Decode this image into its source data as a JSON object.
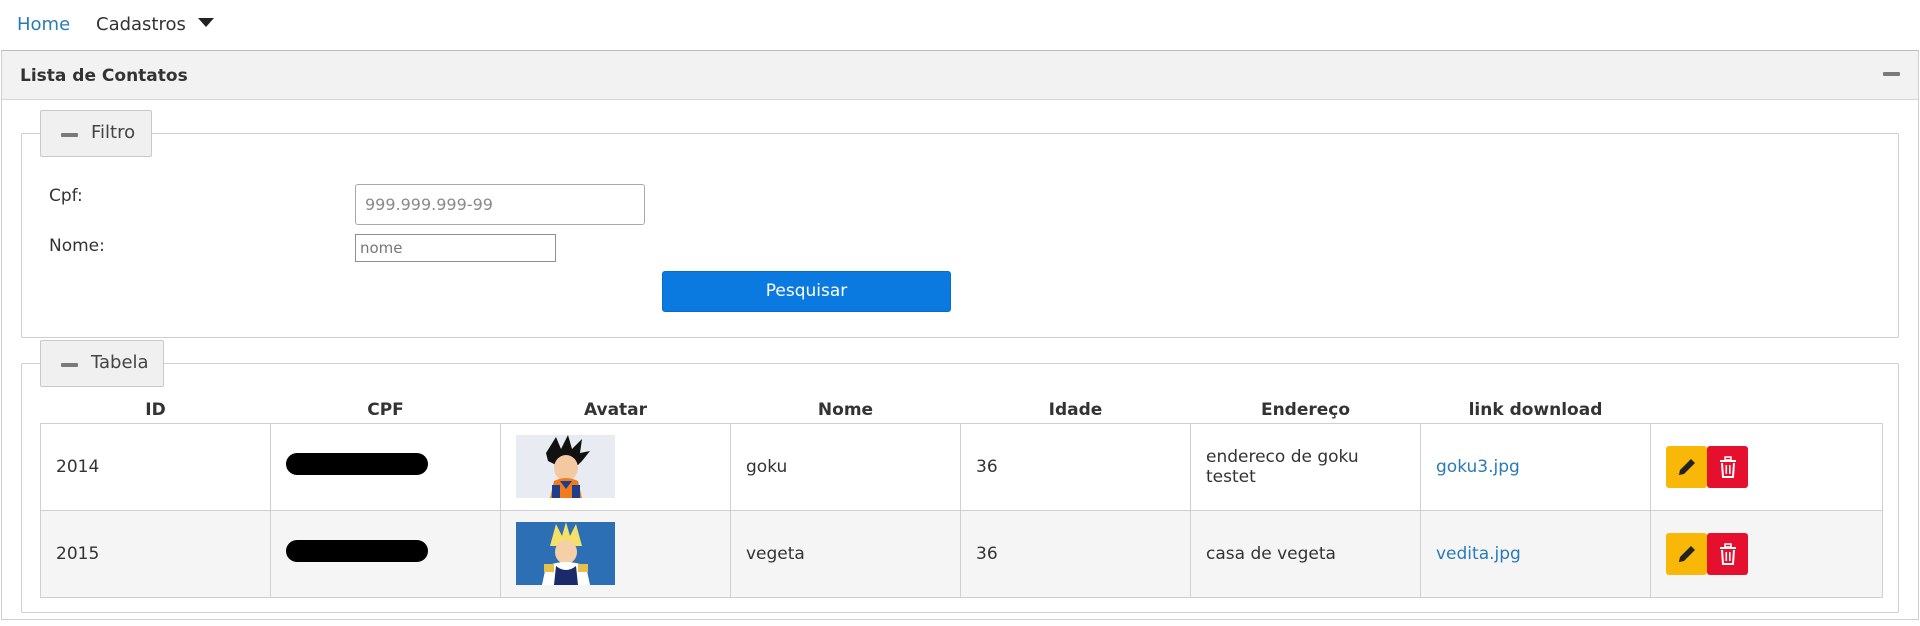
{
  "nav": {
    "home": "Home",
    "cadastros": "Cadastros"
  },
  "panel": {
    "title": "Lista de Contatos"
  },
  "filter": {
    "legend": "Filtro",
    "cpf_label": "Cpf:",
    "cpf_placeholder": "999.999.999-99",
    "nome_label": "Nome:",
    "nome_placeholder": "nome",
    "search_label": "Pesquisar"
  },
  "table": {
    "legend": "Tabela",
    "headers": [
      "ID",
      "CPF",
      "Avatar",
      "Nome",
      "Idade",
      "Endereço",
      "link download",
      ""
    ],
    "rows": [
      {
        "id": "2014",
        "nome": "goku",
        "idade": "36",
        "endereco": "endereco de goku testet",
        "link": "goku3.jpg"
      },
      {
        "id": "2015",
        "nome": "vegeta",
        "idade": "36",
        "endereco": "casa de vegeta",
        "link": "vedita.jpg"
      }
    ]
  },
  "icons": {
    "edit": "pencil-icon",
    "delete": "trash-icon",
    "collapse": "minus-icon",
    "dropdown": "caret-down-icon"
  },
  "colors": {
    "link": "#2a7ab8",
    "primary": "#0b7ae0",
    "warning": "#f9b707",
    "danger": "#e5102e"
  }
}
